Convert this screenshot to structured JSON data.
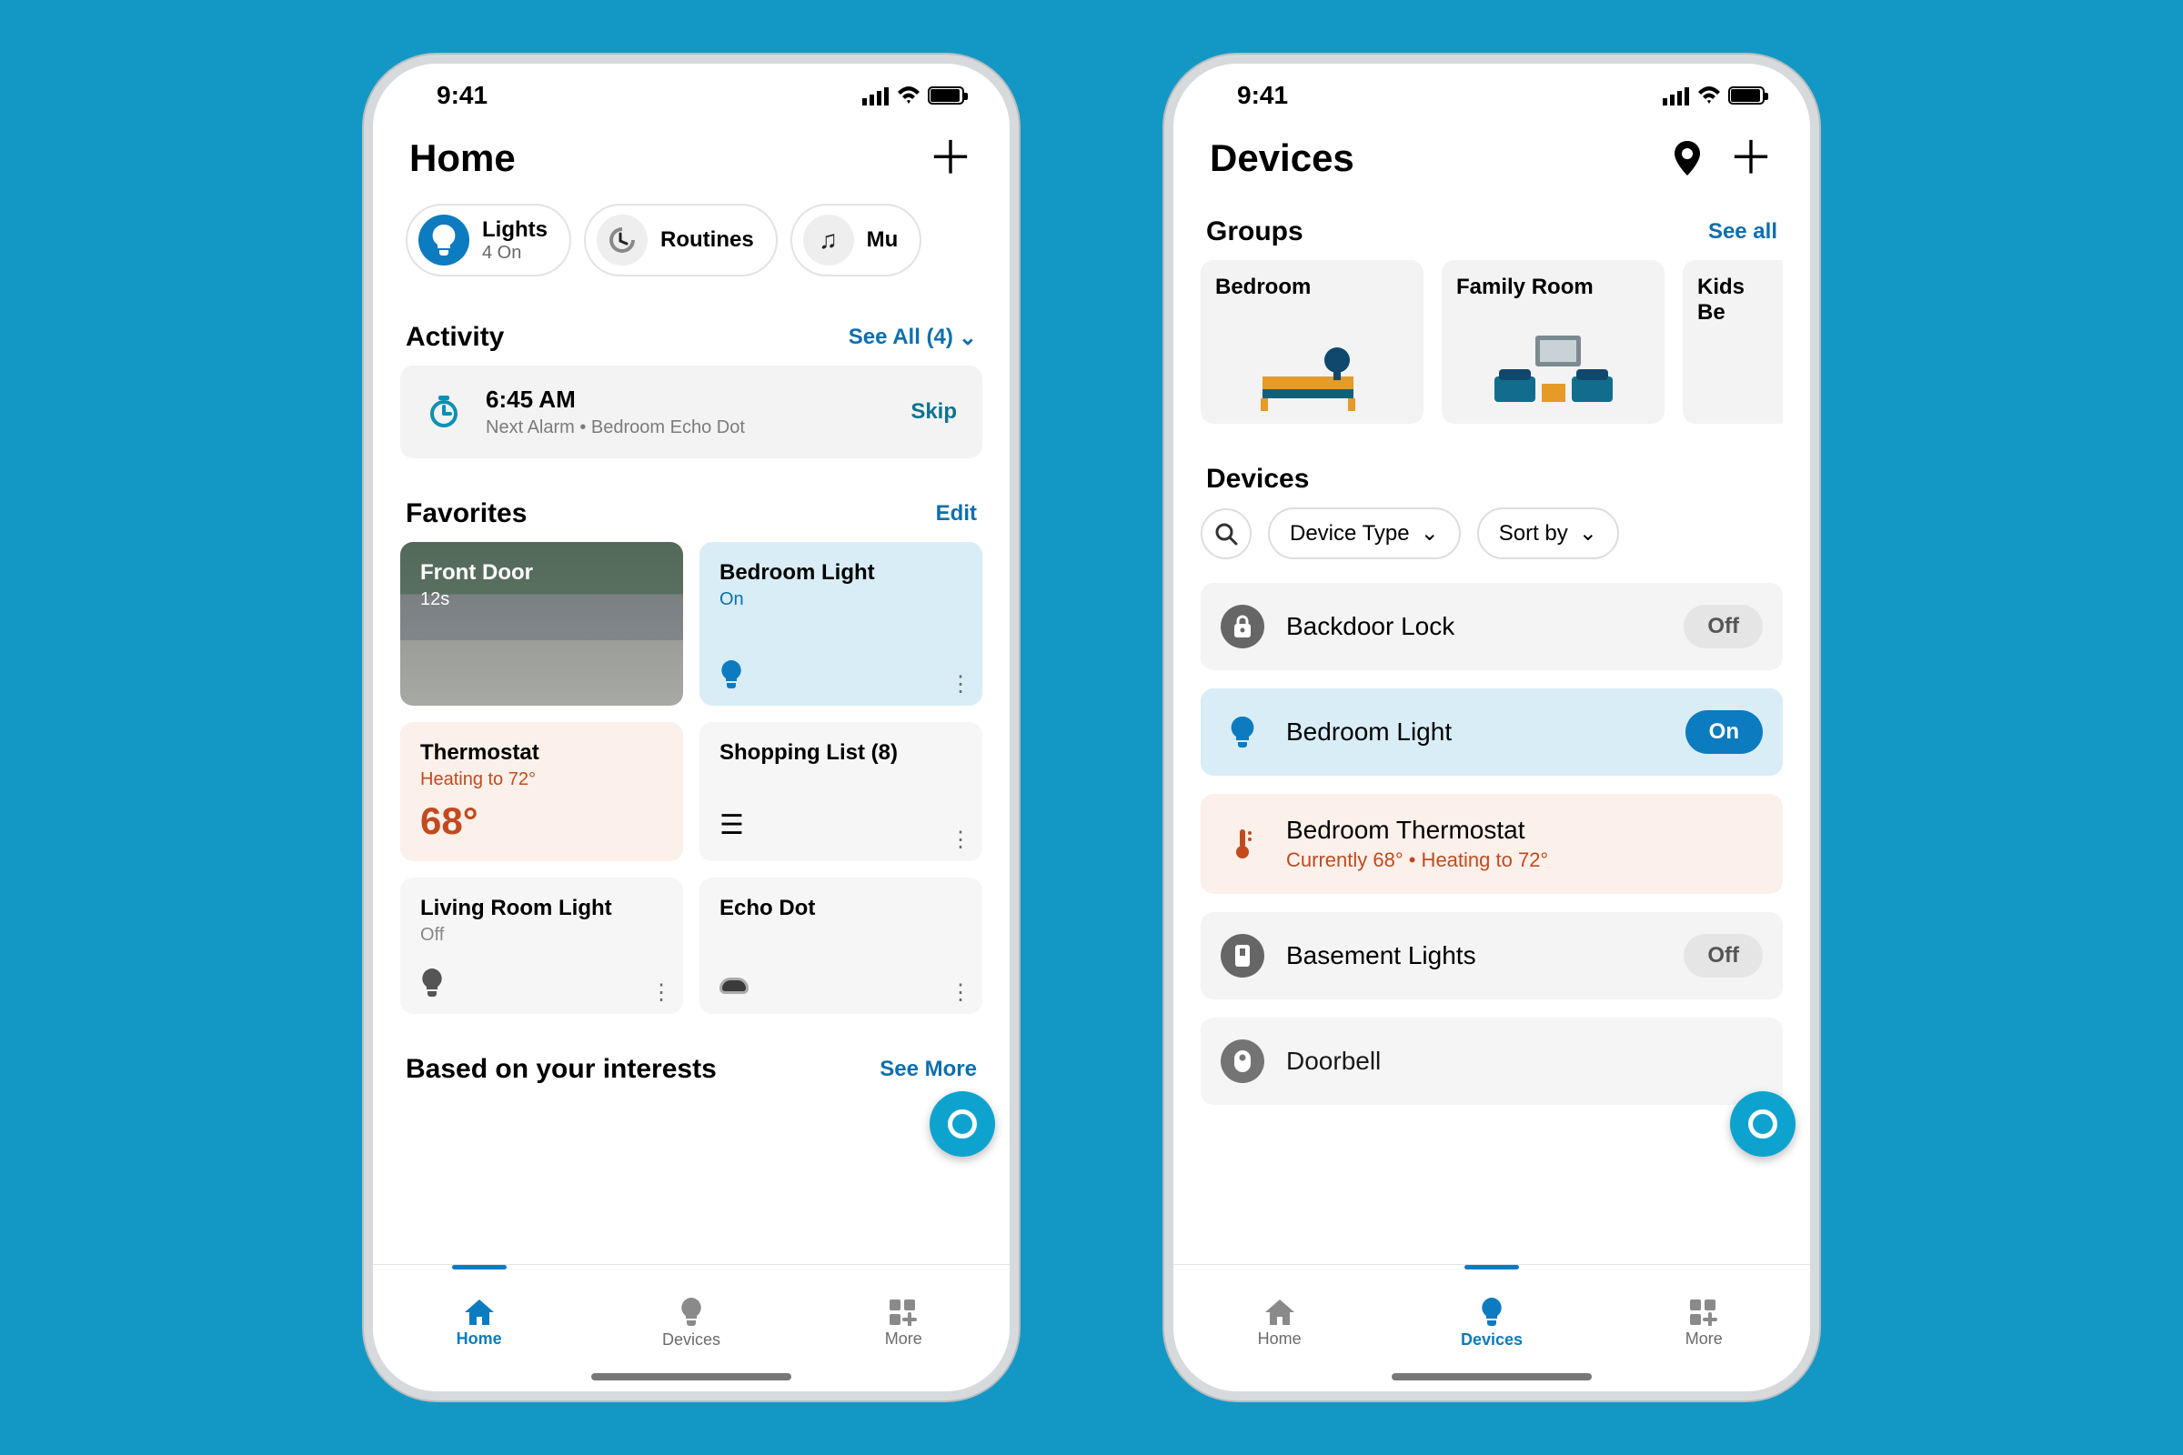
{
  "status": {
    "time": "9:41"
  },
  "home": {
    "title": "Home",
    "chips": {
      "lights": {
        "label": "Lights",
        "sub": "4 On"
      },
      "routines": {
        "label": "Routines"
      },
      "music": {
        "label": "Mu"
      }
    },
    "activity": {
      "heading": "Activity",
      "seeall": "See All (4)",
      "alarm_time": "6:45 AM",
      "alarm_sub": "Next Alarm • Bedroom Echo Dot",
      "skip": "Skip"
    },
    "favorites": {
      "heading": "Favorites",
      "edit": "Edit",
      "front_door": {
        "title": "Front Door",
        "sub": "12s"
      },
      "bedroom_light": {
        "title": "Bedroom Light",
        "sub": "On"
      },
      "thermostat": {
        "title": "Thermostat",
        "sub": "Heating to 72°",
        "temp": "68°"
      },
      "shopping": {
        "title": "Shopping List (8)"
      },
      "living": {
        "title": "Living Room Light",
        "sub": "Off"
      },
      "echodot": {
        "title": "Echo Dot"
      }
    },
    "interests": {
      "heading": "Based on your interests",
      "seemore": "See More"
    },
    "tabs": {
      "home": "Home",
      "devices": "Devices",
      "more": "More"
    }
  },
  "devices": {
    "title": "Devices",
    "groups_heading": "Groups",
    "seeall": "See all",
    "groups": {
      "bedroom": "Bedroom",
      "family": "Family Room",
      "kids": "Kids Be"
    },
    "devices_heading": "Devices",
    "filters": {
      "type": "Device Type",
      "sort": "Sort by"
    },
    "list": {
      "backdoor": {
        "name": "Backdoor Lock",
        "state": "Off"
      },
      "bedlight": {
        "name": "Bedroom Light",
        "state": "On"
      },
      "bedtherm": {
        "name": "Bedroom Thermostat",
        "sub": "Currently 68° • Heating to 72°"
      },
      "basement": {
        "name": "Basement Lights",
        "state": "Off"
      },
      "doorbell": {
        "name": "Doorbell"
      }
    },
    "tabs": {
      "home": "Home",
      "devices": "Devices",
      "more": "More"
    }
  }
}
